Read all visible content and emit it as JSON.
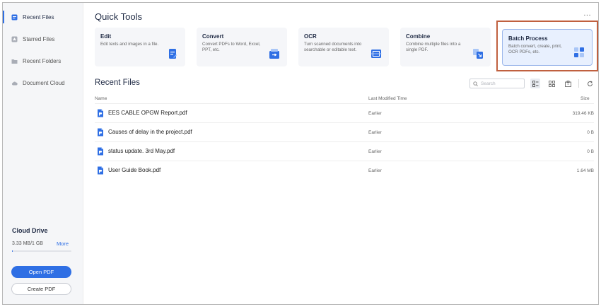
{
  "sidebar": {
    "items": [
      {
        "label": "Recent Files",
        "icon": "recent-files-icon",
        "active": true
      },
      {
        "label": "Starred Files",
        "icon": "star-icon",
        "active": false
      },
      {
        "label": "Recent Folders",
        "icon": "folder-icon",
        "active": false
      },
      {
        "label": "Document Cloud",
        "icon": "cloud-icon",
        "active": false
      }
    ],
    "cloud": {
      "title": "Cloud Drive",
      "usage": "3.33 MB/1 GB",
      "more": "More",
      "used_fraction": 0.0033
    },
    "open_button": "Open PDF",
    "create_button": "Create PDF"
  },
  "quick_tools": {
    "title": "Quick Tools",
    "more": "...",
    "tools": [
      {
        "name": "Edit",
        "desc": "Edit texts and images in a file.",
        "icon": "edit-icon"
      },
      {
        "name": "Convert",
        "desc": "Convert PDFs to Word, Excel, PPT, etc.",
        "icon": "convert-icon"
      },
      {
        "name": "OCR",
        "desc": "Turn scanned documents into searchable or editable text.",
        "icon": "ocr-icon"
      },
      {
        "name": "Combine",
        "desc": "Combine multiple files into a single PDF.",
        "icon": "combine-icon"
      },
      {
        "name": "Batch Process",
        "desc": "Batch convert, create, print, OCR PDFs, etc.",
        "icon": "batch-icon",
        "selected": true
      }
    ]
  },
  "recent_files": {
    "title": "Recent Files",
    "search_placeholder": "Search",
    "columns": {
      "name": "Name",
      "time": "Last Modified Time",
      "size": "Size"
    },
    "files": [
      {
        "name": "EES CABLE OPGW Report.pdf",
        "time": "Earlier",
        "size": "319.46 KB"
      },
      {
        "name": "Causes of delay in the project.pdf",
        "time": "Earlier",
        "size": "0 B"
      },
      {
        "name": "status update. 3rd May.pdf",
        "time": "Earlier",
        "size": "0 B"
      },
      {
        "name": "User Guide Book.pdf",
        "time": "Earlier",
        "size": "1.64 MB"
      }
    ]
  },
  "colors": {
    "accent": "#2f6fe4",
    "highlight": "#c0603f",
    "sidebar_bg": "#f5f6f8"
  }
}
